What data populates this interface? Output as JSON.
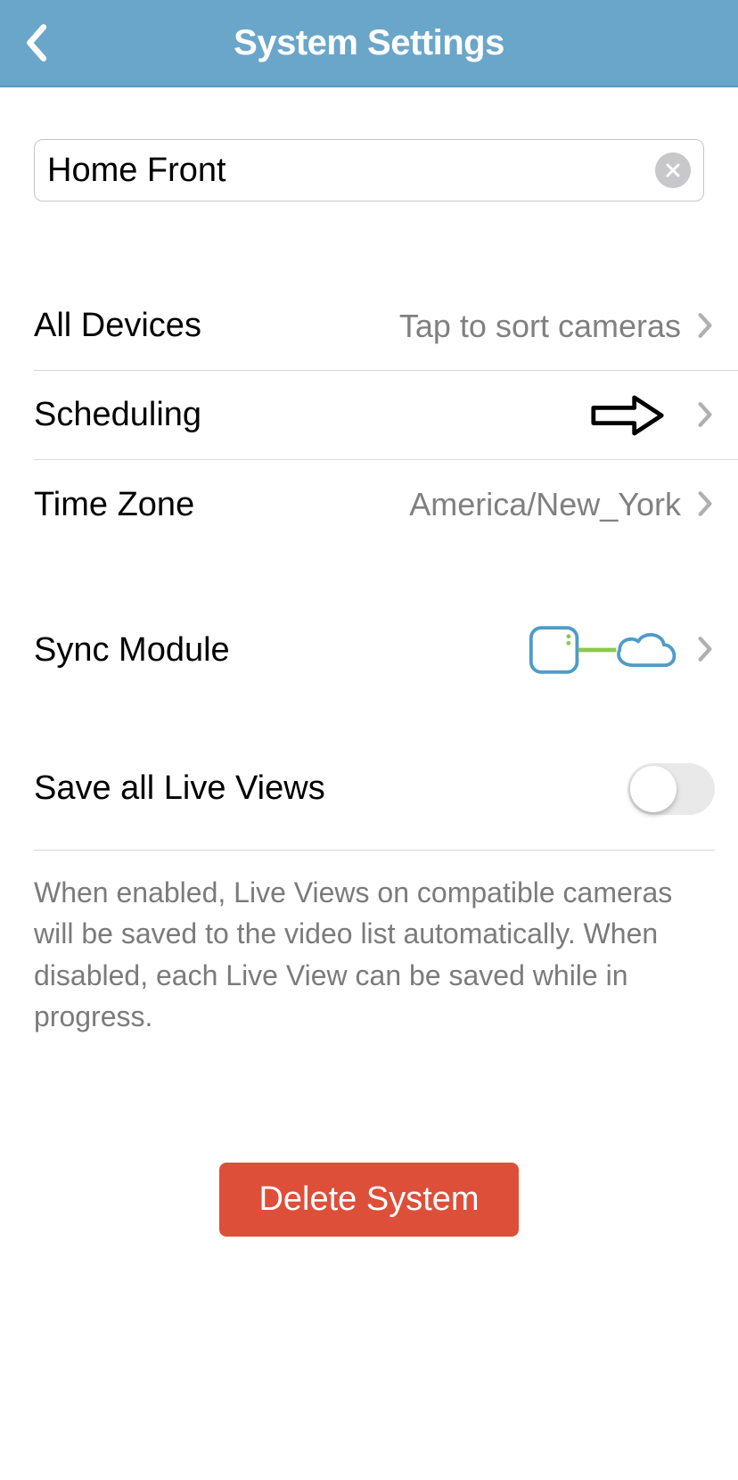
{
  "header": {
    "title": "System Settings"
  },
  "system_name": {
    "value": "Home Front"
  },
  "rows": {
    "all_devices": {
      "label": "All Devices",
      "value": "Tap to sort cameras"
    },
    "scheduling": {
      "label": "Scheduling"
    },
    "time_zone": {
      "label": "Time Zone",
      "value": "America/New_York"
    },
    "sync_module": {
      "label": "Sync Module"
    },
    "save_live_views": {
      "label": "Save all Live Views",
      "enabled": false,
      "description": "When enabled, Live Views on compatible cameras will be saved to the video list automatically. When disabled, each Live View can be saved while in progress."
    }
  },
  "delete_button": {
    "label": "Delete System"
  },
  "colors": {
    "header_bg": "#6aa6c9",
    "delete_bg": "#de4f3a"
  }
}
